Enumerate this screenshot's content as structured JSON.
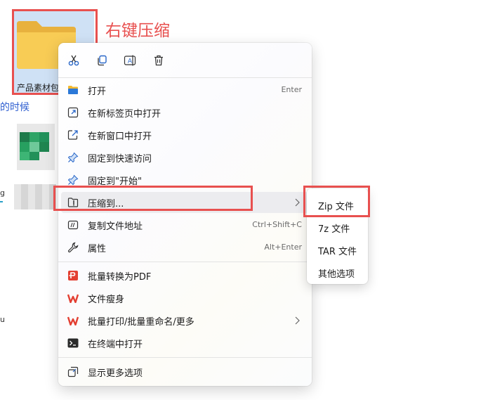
{
  "annotation": {
    "text": "右键压缩"
  },
  "folder": {
    "label": "产品素材包"
  },
  "background": {
    "link_fragment": "的时候"
  },
  "toolbar": {
    "icons": [
      "scissors-icon",
      "copy-icon",
      "rename-icon",
      "trash-icon"
    ]
  },
  "menu": {
    "items": [
      {
        "label": "打开",
        "shortcut": "Enter"
      },
      {
        "label": "在新标签页中打开",
        "shortcut": ""
      },
      {
        "label": "在新窗口中打开",
        "shortcut": ""
      },
      {
        "label": "固定到快速访问",
        "shortcut": ""
      },
      {
        "label": "固定到\"开始\"",
        "shortcut": ""
      },
      {
        "label": "压缩到...",
        "shortcut": ""
      },
      {
        "label": "复制文件地址",
        "shortcut": "Ctrl+Shift+C"
      },
      {
        "label": "属性",
        "shortcut": "Alt+Enter"
      },
      {
        "label": "批量转换为PDF",
        "shortcut": ""
      },
      {
        "label": "文件瘦身",
        "shortcut": ""
      },
      {
        "label": "批量打印/批量重命名/更多",
        "shortcut": ""
      },
      {
        "label": "在终端中打开",
        "shortcut": ""
      },
      {
        "label": "显示更多选项",
        "shortcut": ""
      }
    ]
  },
  "submenu": {
    "items": [
      {
        "label": "Zip 文件"
      },
      {
        "label": "7z 文件"
      },
      {
        "label": "TAR 文件"
      },
      {
        "label": "其他选项"
      }
    ]
  },
  "colors": {
    "highlight_red": "#e8504f",
    "folder_yellow": "#f8cc55",
    "wps_red": "#e33f32",
    "link_blue": "#2f5fd0"
  }
}
